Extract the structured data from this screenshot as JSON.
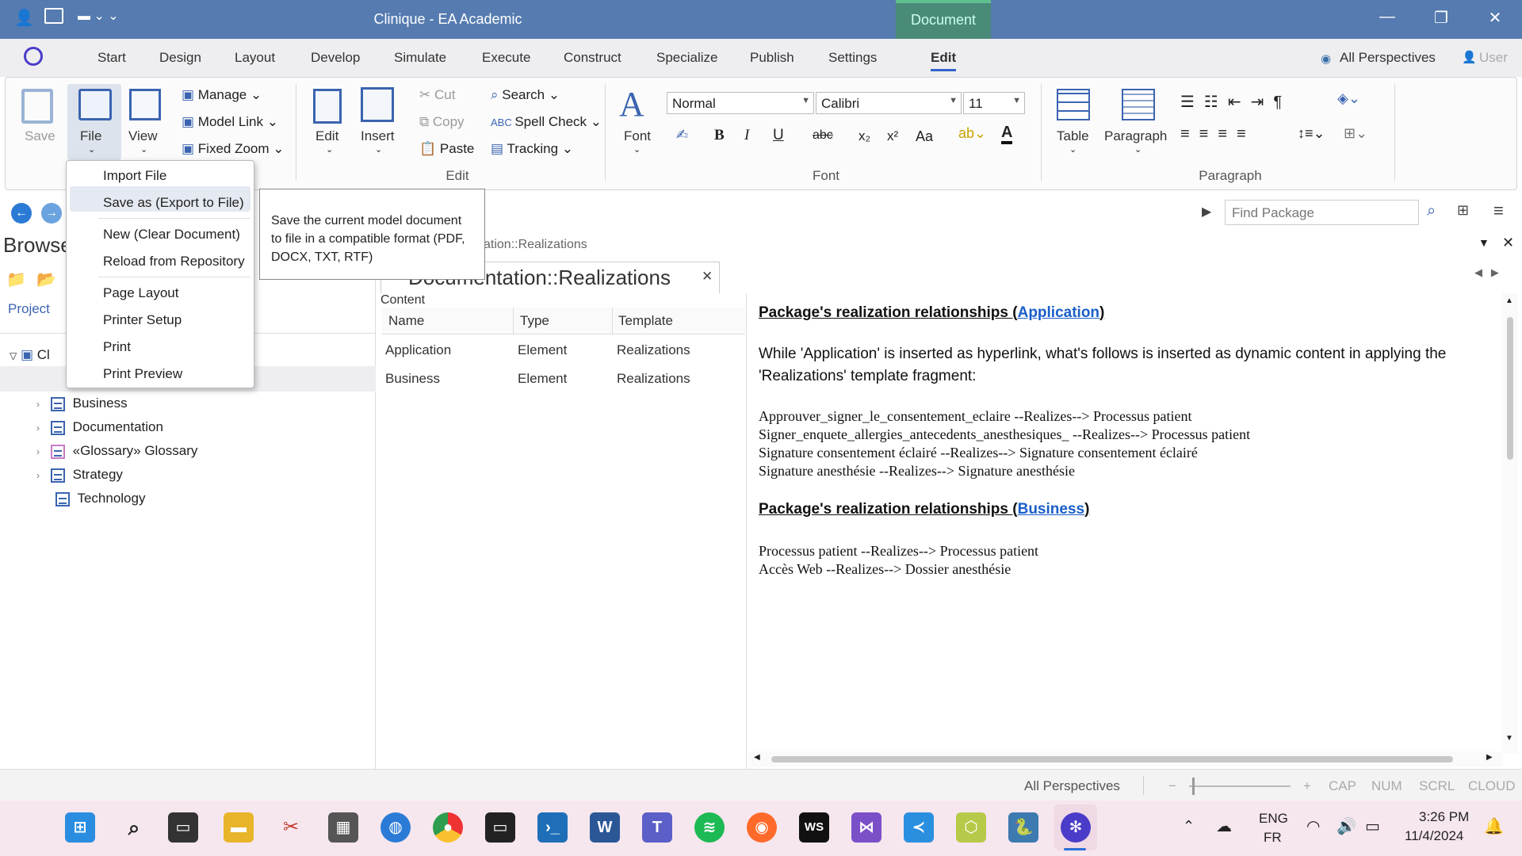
{
  "window": {
    "title": "Clinique - EA Academic",
    "context_tab": "Document",
    "controls": [
      "—",
      "❐",
      "✕"
    ]
  },
  "ribbon_tabs": [
    "Start",
    "Design",
    "Layout",
    "Develop",
    "Simulate",
    "Execute",
    "Construct",
    "Specialize",
    "Publish",
    "Settings",
    "Edit"
  ],
  "active_tab": "Edit",
  "perspectives": {
    "label": "All Perspectives",
    "user": "User"
  },
  "ribbon": {
    "save": "Save",
    "file": "File",
    "view": "View",
    "manage": "Manage",
    "model_link": "Model Link",
    "fixed_zoom": "Fixed Zoom",
    "edit": "Edit",
    "insert": "Insert",
    "cut": "Cut",
    "copy": "Copy",
    "paste": "Paste",
    "search": "Search",
    "spell_check": "Spell Check",
    "tracking": "Tracking",
    "edit_group": "Edit",
    "font": "Font",
    "style_value": "Normal",
    "font_value": "Calibri",
    "size_value": "11",
    "font_group": "Font",
    "table": "Table",
    "paragraph": "Paragraph",
    "paragraph_group": "Paragraph",
    "fmt": {
      "bold": "B",
      "italic": "I",
      "underline": "U",
      "strike": "abc",
      "sub": "x₂",
      "sup": "x²",
      "case": "Aa"
    }
  },
  "file_menu": {
    "items": [
      "Import File",
      "Save as (Export to File)",
      "New (Clear Document)",
      "Reload from Repository",
      "Page Layout",
      "Printer Setup",
      "Print",
      "Print Preview"
    ],
    "tooltip": "Save the current model document to file in a compatible format (PDF, DOCX, TXT, RTF)"
  },
  "find": {
    "placeholder": "Find Package"
  },
  "browser": {
    "title": "Browse",
    "tab_project": "Project",
    "root": "Cl",
    "items": [
      "Business",
      "Documentation",
      "«Glossary» Glossary",
      "Strategy",
      "Technology"
    ]
  },
  "doc": {
    "breadcrumb": "ation::Realizations",
    "tab_title": "Documentation::Realizations",
    "close": "✕",
    "content_label": "Content",
    "columns": [
      "Name",
      "Type",
      "Template"
    ],
    "rows": [
      [
        "Application",
        "Element",
        "Realizations"
      ],
      [
        "Business",
        "Element",
        "Realizations"
      ]
    ]
  },
  "rtf": {
    "h1_pre": "Package's realization relationships (",
    "h1_link": "Application",
    "h1_post": ")",
    "para_a": "While 'Application' is inserted as hyperlink, what's follows is inserted as dynamic content in applying the",
    "para_b": "'Realizations' template fragment:",
    "lines1": [
      "Approuver_signer_le_consentement_eclaire --Realizes--> Processus patient",
      "Signer_enquete_allergies_antecedents_anesthesiques_ --Realizes--> Processus patient",
      "Signature consentement éclairé --Realizes--> Signature consentement éclairé",
      "Signature anesthésie --Realizes--> Signature anesthésie"
    ],
    "h2_pre": "Package's realization relationships (",
    "h2_link": "Business",
    "h2_post": ")",
    "lines2": [
      "Processus patient --Realizes--> Processus patient",
      "Accès Web --Realizes--> Dossier anesthésie"
    ]
  },
  "status": {
    "perspectives": "All Perspectives",
    "minus": "−",
    "plus": "+",
    "cap": "CAP",
    "num": "NUM",
    "scrl": "SCRL",
    "cloud": "CLOUD"
  },
  "taskbar": {
    "lang1": "ENG",
    "lang2": "FR",
    "time": "3:26 PM",
    "date": "11/4/2024"
  },
  "colors": {
    "titlebar": "#557bb0",
    "accent": "#3264c8",
    "link": "#1a5ec9",
    "taskbar": "#f6e6ee"
  }
}
